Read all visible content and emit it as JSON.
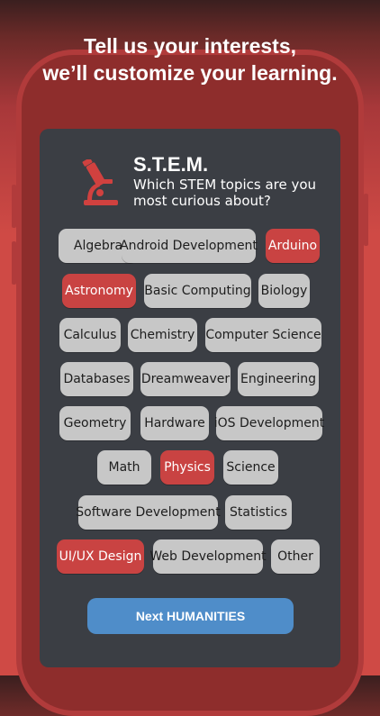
{
  "headline": {
    "line1": "Tell us your interests,",
    "line2": "we’ll customize your learning."
  },
  "colors": {
    "background_red": "#cf4a45",
    "card": "#3b3e44",
    "chip": "#c7c7c7",
    "chip_selected": "#c94342",
    "button": "#4f8dc9"
  },
  "category": {
    "icon": "microscope-icon",
    "title": "S.T.E.M.",
    "question": "Which STEM topics are you most curious about?"
  },
  "topics": [
    {
      "label": "Algebra",
      "selected": false
    },
    {
      "label": "Android Development",
      "selected": false
    },
    {
      "label": "Arduino",
      "selected": true
    },
    {
      "label": "Astronomy",
      "selected": true
    },
    {
      "label": "Basic Computing",
      "selected": false
    },
    {
      "label": "Biology",
      "selected": false
    },
    {
      "label": "Calculus",
      "selected": false
    },
    {
      "label": "Chemistry",
      "selected": false
    },
    {
      "label": "Computer Science",
      "selected": false
    },
    {
      "label": "Databases",
      "selected": false
    },
    {
      "label": "Dreamweaver",
      "selected": false
    },
    {
      "label": "Engineering",
      "selected": false
    },
    {
      "label": "Geometry",
      "selected": false
    },
    {
      "label": "Hardware",
      "selected": false
    },
    {
      "label": "iOS Development",
      "selected": false
    },
    {
      "label": "Math",
      "selected": false
    },
    {
      "label": "Physics",
      "selected": true
    },
    {
      "label": "Science",
      "selected": false
    },
    {
      "label": "Software Development",
      "selected": false
    },
    {
      "label": "Statistics",
      "selected": false
    },
    {
      "label": "UI/UX Design",
      "selected": true
    },
    {
      "label": "Web Development",
      "selected": false
    },
    {
      "label": "Other",
      "selected": false
    }
  ],
  "next_button": {
    "label": "Next HUMANITIES"
  }
}
